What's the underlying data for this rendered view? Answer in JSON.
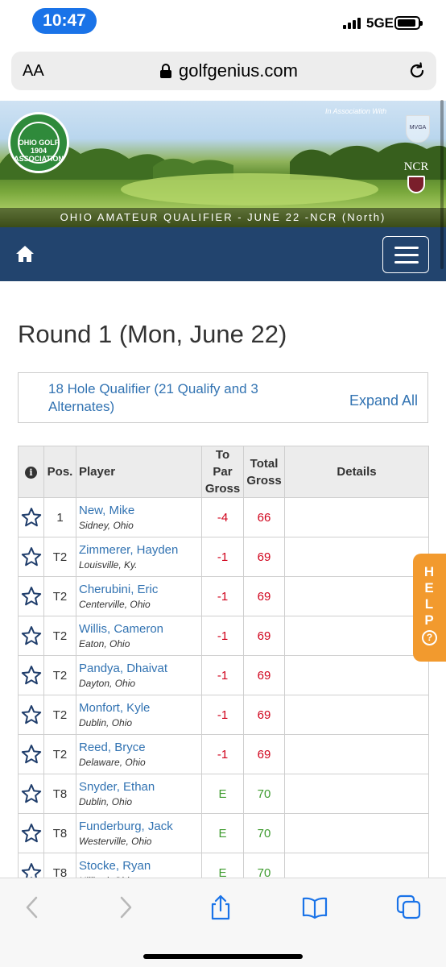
{
  "status_bar": {
    "time": "10:47",
    "network": "5GE"
  },
  "browser": {
    "text_size_label": "AA",
    "url": "golfgenius.com"
  },
  "banner": {
    "logo_text": "OHIO GOLF 1904 ASSOCIATION",
    "association_note": "In Association With",
    "crest_text": "MVGA",
    "ncr_text": "NCR",
    "caption": "OHIO AMATEUR QUALIFIER - JUNE 22 -NCR (North)"
  },
  "page": {
    "round_title": "Round 1 (Mon, June 22)",
    "qualifier_title": "18 Hole Qualifier (21 Qualify and 3 Alternates)",
    "expand_all": "Expand All"
  },
  "table": {
    "headers": {
      "info": "i",
      "pos": "Pos.",
      "player": "Player",
      "to_par_line1": "To Par",
      "to_par_line2": "Gross",
      "total_line1": "Total",
      "total_line2": "Gross",
      "details": "Details"
    },
    "rows": [
      {
        "pos": "1",
        "name": "New, Mike",
        "home": "Sidney, Ohio",
        "to_par": "-4",
        "total": "66",
        "color": "red"
      },
      {
        "pos": "T2",
        "name": "Zimmerer, Hayden",
        "home": "Louisville, Ky.",
        "to_par": "-1",
        "total": "69",
        "color": "red"
      },
      {
        "pos": "T2",
        "name": "Cherubini, Eric",
        "home": "Centerville, Ohio",
        "to_par": "-1",
        "total": "69",
        "color": "red"
      },
      {
        "pos": "T2",
        "name": "Willis, Cameron",
        "home": "Eaton, Ohio",
        "to_par": "-1",
        "total": "69",
        "color": "red"
      },
      {
        "pos": "T2",
        "name": "Pandya, Dhaivat",
        "home": "Dayton, Ohio",
        "to_par": "-1",
        "total": "69",
        "color": "red"
      },
      {
        "pos": "T2",
        "name": "Monfort, Kyle",
        "home": "Dublin, Ohio",
        "to_par": "-1",
        "total": "69",
        "color": "red"
      },
      {
        "pos": "T2",
        "name": "Reed, Bryce",
        "home": "Delaware, Ohio",
        "to_par": "-1",
        "total": "69",
        "color": "red"
      },
      {
        "pos": "T8",
        "name": "Snyder, Ethan",
        "home": "Dublin, Ohio",
        "to_par": "E",
        "total": "70",
        "color": "green"
      },
      {
        "pos": "T8",
        "name": "Funderburg, Jack",
        "home": "Westerville, Ohio",
        "to_par": "E",
        "total": "70",
        "color": "green"
      },
      {
        "pos": "T8",
        "name": "Stocke, Ryan",
        "home": "Hilliard, Ohio",
        "to_par": "E",
        "total": "70",
        "color": "green"
      }
    ]
  },
  "help_tab": {
    "letters": [
      "H",
      "E",
      "L",
      "P"
    ],
    "question": "?"
  },
  "colors": {
    "navbar": "#22446e",
    "link": "#3273b2",
    "under_par": "#d0021b",
    "even_par": "#3c9a2d",
    "help": "#f29a2e"
  }
}
